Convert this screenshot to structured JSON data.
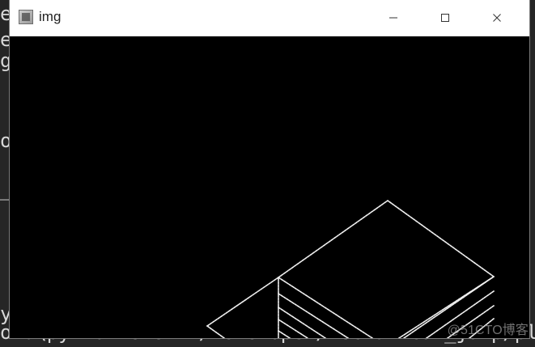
{
  "window": {
    "title": "img",
    "icon": "app-window-icon",
    "controls": {
      "minimize": "minimize-icon",
      "maximize": "maximize-icon",
      "close": "close-icon"
    }
  },
  "terminal": {
    "visible_text_bottom": "ots\\python.exe D:/Developer/Mechanical_jump/play."
  },
  "watermark": "@51CTO博客",
  "colors": {
    "window_bg": "#000000",
    "titlebar_bg": "#ffffff",
    "line_color": "#f2f2f2"
  }
}
